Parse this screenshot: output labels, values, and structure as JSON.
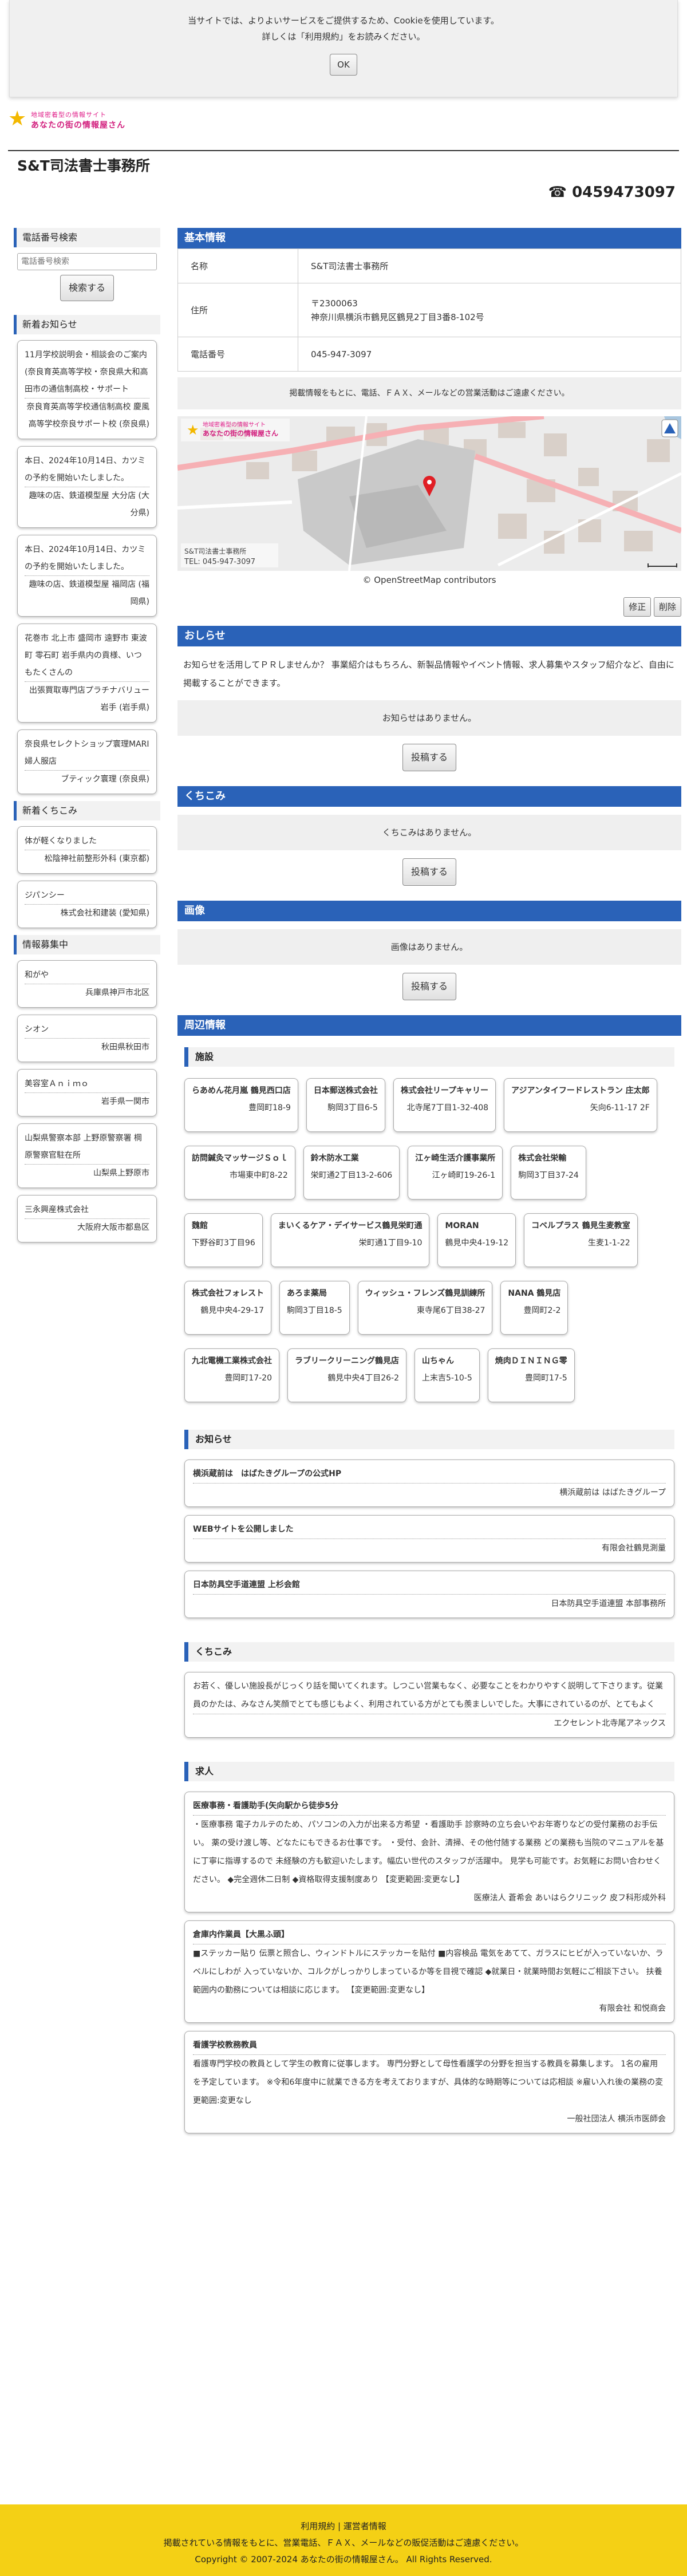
{
  "cookie": {
    "line1": "当サイトでは、よりよいサービスをご提供するため、Cookieを使用しています。",
    "line2": "詳しくは「利用規約」をお読みください。",
    "ok": "OK"
  },
  "logo": {
    "line1": "地域密着型の情報サイト",
    "line2": "あなたの街の情報屋さん"
  },
  "site_name": "S&T司法書士事務所",
  "phone": "☎ 0459473097",
  "sidebar": {
    "search_heading": "電話番号検索",
    "search_placeholder": "電話番号検索",
    "search_button": "検索する",
    "news_heading": "新着お知らせ",
    "news": [
      {
        "text": "11月学校説明会・相談会のご案内(奈良育英高等学校・奈良県大和高田市の通信制高校・サポート",
        "who": "奈良育英高等学校通信制高校 慶風高等学校奈良サポート校 (奈良県)"
      },
      {
        "text": "本日、2024年10月14日、カツミの予約を開始いたしました。",
        "who": "趣味の店、鉄道模型屋 大分店 (大分県)"
      },
      {
        "text": "本日、2024年10月14日、カツミの予約を開始いたしました。",
        "who": "趣味の店、鉄道模型屋 福岡店 (福岡県)"
      },
      {
        "text": "花巻市 北上市 盛岡市 遠野市 東波町 零石町 岩手県内の貢様、いつもたくさんの",
        "who": "出張買取専門店プラチナバリュー岩手 (岩手県)"
      },
      {
        "text": "奈良県セレクトショップ寰理MARI 婦人服店",
        "who": "ブティック寰理 (奈良県)"
      }
    ],
    "reviews_heading": "新着くちこみ",
    "reviews": [
      {
        "text": "体が軽くなりました",
        "who": "松陰神社前整形外科 (東京都)"
      },
      {
        "text": "ジパンシー",
        "who": "株式会社和建装 (愛知県)"
      }
    ],
    "info_heading": "情報募集中",
    "info": [
      {
        "text": "和がや",
        "who": "兵庫県神戸市北区"
      },
      {
        "text": "シオン",
        "who": "秋田県秋田市"
      },
      {
        "text": "美容室Ａｎｉｍｏ",
        "who": "岩手県一関市"
      },
      {
        "text": "山梨県警察本部 上野原警察署 棡原警察官駐在所",
        "who": "山梨県上野原市"
      },
      {
        "text": "三永興産株式会社",
        "who": "大阪府大阪市都島区"
      }
    ]
  },
  "basic": {
    "heading": "基本情報",
    "rows": [
      {
        "key": "名称",
        "value": "S&T司法書士事務所"
      },
      {
        "key": "住所",
        "value": "〒2300063",
        "value2": "神奈川県横浜市鶴見区鶴見2丁目3番8-102号"
      },
      {
        "key": "電話番号",
        "value": "045-947-3097"
      }
    ],
    "note": "掲載情報をもとに、電話、ＦＡＸ、メールなどの営業活動はご遠慮ください。"
  },
  "map": {
    "logo_line1": "地域密着型の情報サイト",
    "logo_line2": "あなたの街の情報屋さん",
    "caption_name": "S&T司法書士事務所",
    "caption_tel": "TEL: 045-947-3097",
    "credit": "© OpenStreetMap contributors",
    "water_color": "#a9c7e0",
    "road_color": "#f6b0b4"
  },
  "edit": {
    "fix": "修正",
    "delete": "削除"
  },
  "notice": {
    "heading": "おしらせ",
    "text": "お知らせを活用してＰＲしませんか？ 事業紹介はもちろん、新製品情報やイベント情報、求人募集やスタッフ紹介など、自由に掲載することができます。",
    "empty": "お知らせはありません。",
    "post": "投稿する"
  },
  "kuchikomi": {
    "heading": "くちこみ",
    "empty": "くちこみはありません。",
    "post": "投稿する"
  },
  "image": {
    "heading": "画像",
    "empty": "画像はありません。",
    "post": "投稿する"
  },
  "nearby": {
    "heading": "周辺情報",
    "shops_heading": "施設",
    "shops": [
      {
        "name": "らあめん花月嵐 鶴見西口店",
        "addr": "豊岡町18-9"
      },
      {
        "name": "日本郵送株式会社",
        "addr": "駒岡3丁目6-5"
      },
      {
        "name": "株式会社リープキャリー",
        "addr": "北寺尾7丁目1-32-408"
      },
      {
        "name": "アジアンタイフードレストラン 庄太郎",
        "addr": "矢向6-11-17 2F"
      },
      {
        "name": "訪問鍼灸マッサージＳｏｌ",
        "addr": "市場東中町8-22"
      },
      {
        "name": "鈴木防水工業",
        "addr": "栄町通2丁目13-2-606"
      },
      {
        "name": "江ヶ崎生活介護事業所",
        "addr": "江ヶ崎町19-26-1"
      },
      {
        "name": "株式会社栄輸",
        "addr": "駒岡3丁目37-24"
      },
      {
        "name": "魏館",
        "addr": "下野谷町3丁目96"
      },
      {
        "name": "まいくるケア・デイサービス鶴見栄町通",
        "addr": "栄町通1丁目9-10"
      },
      {
        "name": "MORAN",
        "addr": "鶴見中央4-19-12"
      },
      {
        "name": "コベルプラス 鶴見生麦教室",
        "addr": "生麦1-1-22"
      },
      {
        "name": "株式会社フォレスト",
        "addr": "鶴見中央4-29-17"
      },
      {
        "name": "あろま薬局",
        "addr": "駒岡3丁目18-5"
      },
      {
        "name": "ウィッシュ・フレンズ鶴見訓練所",
        "addr": "東寺尾6丁目38-27"
      },
      {
        "name": "NANA 鶴見店",
        "addr": "豊岡町2-2"
      },
      {
        "name": "九北電機工業株式会社",
        "addr": "豊岡町17-20"
      },
      {
        "name": "ラブリークリーニング鶴見店",
        "addr": "鶴見中央4丁目26-2"
      },
      {
        "name": "山ちゃん",
        "addr": "上末吉5-10-5"
      },
      {
        "name": "焼肉ＤＩＮＩＮＧ零",
        "addr": "豊岡町17-5"
      }
    ],
    "news_heading": "お知らせ",
    "news": [
      {
        "title": "横浜蔵前は　はばたきグループの公式HP",
        "source": "横浜蔵前は はばたきグループ"
      },
      {
        "title": "WEBサイトを公開しました",
        "source": "有限会社鶴見測量"
      },
      {
        "title": "日本防具空手道連盟 上杉会館",
        "source": "日本防具空手道連盟 本部事務所"
      }
    ],
    "reviews_heading": "くちこみ",
    "review": {
      "text": "お若く、優しい施設長がじっくり話を聞いてくれます。しつこい営業もなく、必要なことをわかりやすく説明して下さります。従業員のかたは、みなさん笑顔でとても感じもよく、利用されている方がとても羨ましいでした。大事にされているのが、とてもよく",
      "source": "エクセレント北寺尾アネックス"
    },
    "jobs_heading": "求人",
    "jobs": [
      {
        "title": "医療事務・看護助手(矢向駅から徒歩5分",
        "body": "・医療事務 電子カルテのため、パソコンの入力が出来る方希望 ・看護助手 診察時の立ち会いやお年寄りなどの受付業務のお手伝い。 薬の受け渡し等、どなたにもできるお仕事です。 ・受付、会計、清掃、その他付随する業務 どの業務も当院のマニュアルを基に丁寧に指導するので 未経験の方も歓迎いたします。幅広い世代のスタッフが活躍中。 見学も可能です。お気軽にお問い合わせください。 ◆完全週休二日制 ◆資格取得支援制度あり 【変更範囲:変更なし】",
        "source": "医療法人 蒼希会 あいはらクリニック 皮フ科形成外科"
      },
      {
        "title": "倉庫内作業員【大黒ふ頭】",
        "body": "■ステッカー貼り 伝票と照合し、ウィンドトルにステッカーを貼付 ■内容検品 電気をあてて、ガラスにヒビが入っていないか、ラベルにしわが 入っていないか、コルクがしっかりしまっているか等を目視で確認 ◆就業日・就業時間お気軽にご相談下さい。 扶養範囲内の勤務については相談に応じます。 【変更範囲:変更なし】",
        "source": "有限会社 和悦商会"
      },
      {
        "title": "看護学校教務教員",
        "body": "看護専門学校の教員として学生の教育に従事します。 専門分野として母性看護学の分野を担当する教員を募集します。 1名の雇用を予定しています。 ※令和6年度中に就業できる方を考えておりますが、具体的な時期等については応相談 ※雇い入れ後の業務の変更範囲:変更なし",
        "source": "一般社団法人 横浜市医師会"
      }
    ]
  },
  "footer": {
    "links": "利用規約 | 運営者情報",
    "note": "掲載されている情報をもとに、営業電話、ＦＡＸ、メールなどの販促活動はご遠慮ください。",
    "copyright": "Copyright © 2007-2024 あなたの街の情報屋さん。 All Rights Reserved."
  }
}
